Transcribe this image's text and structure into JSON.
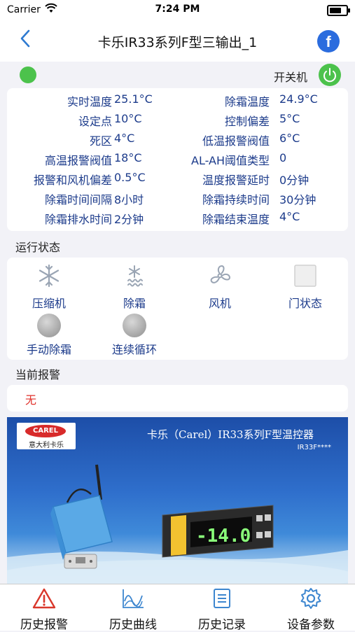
{
  "status_bar": {
    "carrier": "Carrier",
    "time": "7:24 PM"
  },
  "nav": {
    "title": "卡乐IR33系列F型三输出_1",
    "share_icon": "f"
  },
  "power": {
    "label": "开关机",
    "state_color": "#4cc24c"
  },
  "params": [
    {
      "label1": "实时温度",
      "value1": "25.1°C",
      "label2": "除霜温度",
      "value2": "24.9°C"
    },
    {
      "label1": "设定点",
      "value1": "10°C",
      "label2": "控制偏差",
      "value2": "5°C"
    },
    {
      "label1": "死区",
      "value1": "4°C",
      "label2": "低温报警阀值",
      "value2": "6°C"
    },
    {
      "label1": "高温报警阀值",
      "value1": "18°C",
      "label2": "AL-AH阈值类型",
      "value2": "0"
    },
    {
      "label1": "报警和风机偏差",
      "value1": "0.5°C",
      "label2": "温度报警延时",
      "value2": "0分钟"
    },
    {
      "label1": "除霜时间间隔",
      "value1": "8小时",
      "label2": "除霜持续时间",
      "value2": "30分钟"
    },
    {
      "label1": "除霜排水时间",
      "value1": "2分钟",
      "label2": "除霜结束温度",
      "value2": "4°C"
    }
  ],
  "run_state": {
    "title": "运行状态",
    "items": [
      {
        "label": "压缩机",
        "icon": "snowflake-icon"
      },
      {
        "label": "除霜",
        "icon": "defrost-icon"
      },
      {
        "label": "风机",
        "icon": "fan-icon"
      },
      {
        "label": "门状态",
        "icon": "door-icon"
      },
      {
        "label": "手动除霜",
        "icon": "indicator-ball"
      },
      {
        "label": "连续循环",
        "icon": "indicator-ball"
      }
    ]
  },
  "alarms": {
    "title": "当前报警",
    "value": "无"
  },
  "banner": {
    "logo_text": "CAREL",
    "logo_subtext": "意大利卡乐",
    "headline": "卡乐（Carel）IR33系列F型温控器",
    "model": "IR33F****",
    "display_reading": "-14.0"
  },
  "tabs": [
    {
      "label": "历史报警",
      "icon": "warning-icon"
    },
    {
      "label": "历史曲线",
      "icon": "chart-icon"
    },
    {
      "label": "历史记录",
      "icon": "list-icon"
    },
    {
      "label": "设备参数",
      "icon": "gear-icon"
    }
  ]
}
